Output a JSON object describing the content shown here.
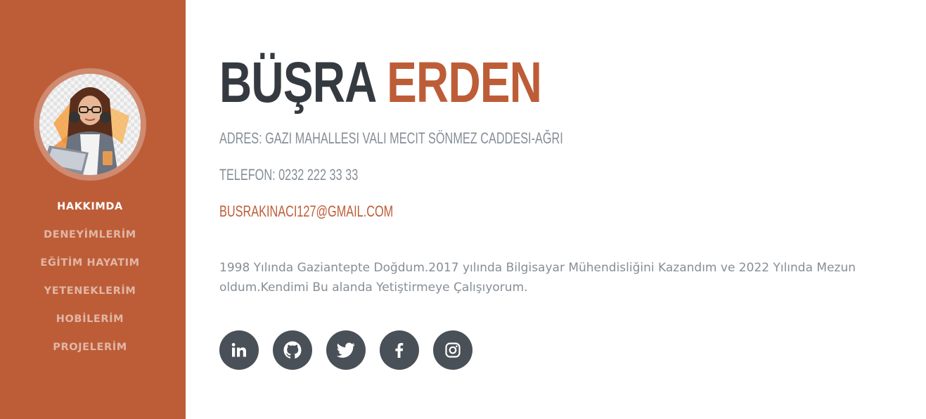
{
  "profile": {
    "first_name": "BÜŞRA",
    "last_name": "ERDEN",
    "address": "ADRES: GAZI MAHALLESI VALI MECIT SÖNMEZ CADDESI-AĞRI",
    "phone": "TELEFON: 0232 222 33 33",
    "email": "BUSRAKINACI127@GMAIL.COM",
    "about": "1998 Yılında Gaziantepte Doğdum.2017 yılında Bilgisayar Mühendisliğini Kazandım ve 2022 Yılında Mezun oldum.Kendimi Bu alanda Yetiştirmeye Çalışıyorum."
  },
  "sidebar": {
    "items": [
      {
        "label": "HAKKIMDA",
        "active": true
      },
      {
        "label": "DENEYİMLERİM",
        "active": false
      },
      {
        "label": "EĞİTİM HAYATIM",
        "active": false
      },
      {
        "label": "YETENEKLERİM",
        "active": false
      },
      {
        "label": "HOBİLERİM",
        "active": false
      },
      {
        "label": "PROJELERİM",
        "active": false
      }
    ]
  },
  "social": {
    "icons": [
      "linkedin-icon",
      "github-icon",
      "twitter-icon",
      "facebook-icon",
      "instagram-icon"
    ]
  },
  "colors": {
    "primary": "#bd5d38",
    "heading": "#343a40",
    "muted": "#868e96",
    "social_bg": "#495057"
  }
}
